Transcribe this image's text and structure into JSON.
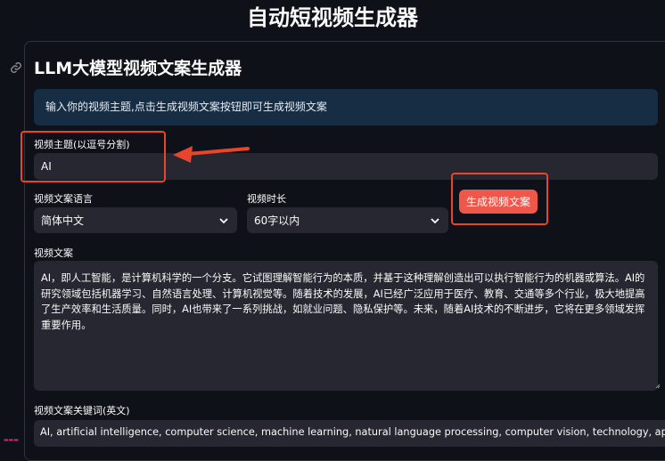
{
  "app": {
    "title": "自动短视频生成器"
  },
  "card": {
    "heading": "LLM大模型视频文案生成器",
    "info": "输入你的视频主题,点击生成视频文案按钮即可生成视频文案"
  },
  "topic": {
    "label": "视频主题(以逗号分割)",
    "value": "AI"
  },
  "language": {
    "label": "视频文案语言",
    "selected": "简体中文"
  },
  "duration": {
    "label": "视频时长",
    "selected": "60字以内"
  },
  "generate_button": {
    "label": "生成视频文案"
  },
  "script": {
    "label": "视频文案",
    "text": "AI，即人工智能，是计算机科学的一个分支。它试图理解智能行为的本质，并基于这种理解创造出可以执行智能行为的机器或算法。AI的研究领域包括机器学习、自然语言处理、计算机视觉等。随着技术的发展，AI已经广泛应用于医疗、教育、交通等多个行业，极大地提高了生产效率和生活质量。同时，AI也带来了一系列挑战，如就业问题、隐私保护等。未来，随着AI技术的不断进步，它将在更多领域发挥重要作用。"
  },
  "keywords": {
    "label": "视频文案关键词(英文)",
    "value": "AI, artificial intelligence, computer science, machine learning, natural language processing, computer vision, technology, applications, challenges"
  },
  "icons": {
    "anchor": "link-icon",
    "caret": "chevron-down-icon",
    "annotation_arrow": "red-arrow-icon"
  },
  "colors": {
    "background": "#0e1117",
    "field": "#262730",
    "info": "#172d43",
    "primary_button": "#f0574b",
    "annotation": "#e8452c"
  }
}
